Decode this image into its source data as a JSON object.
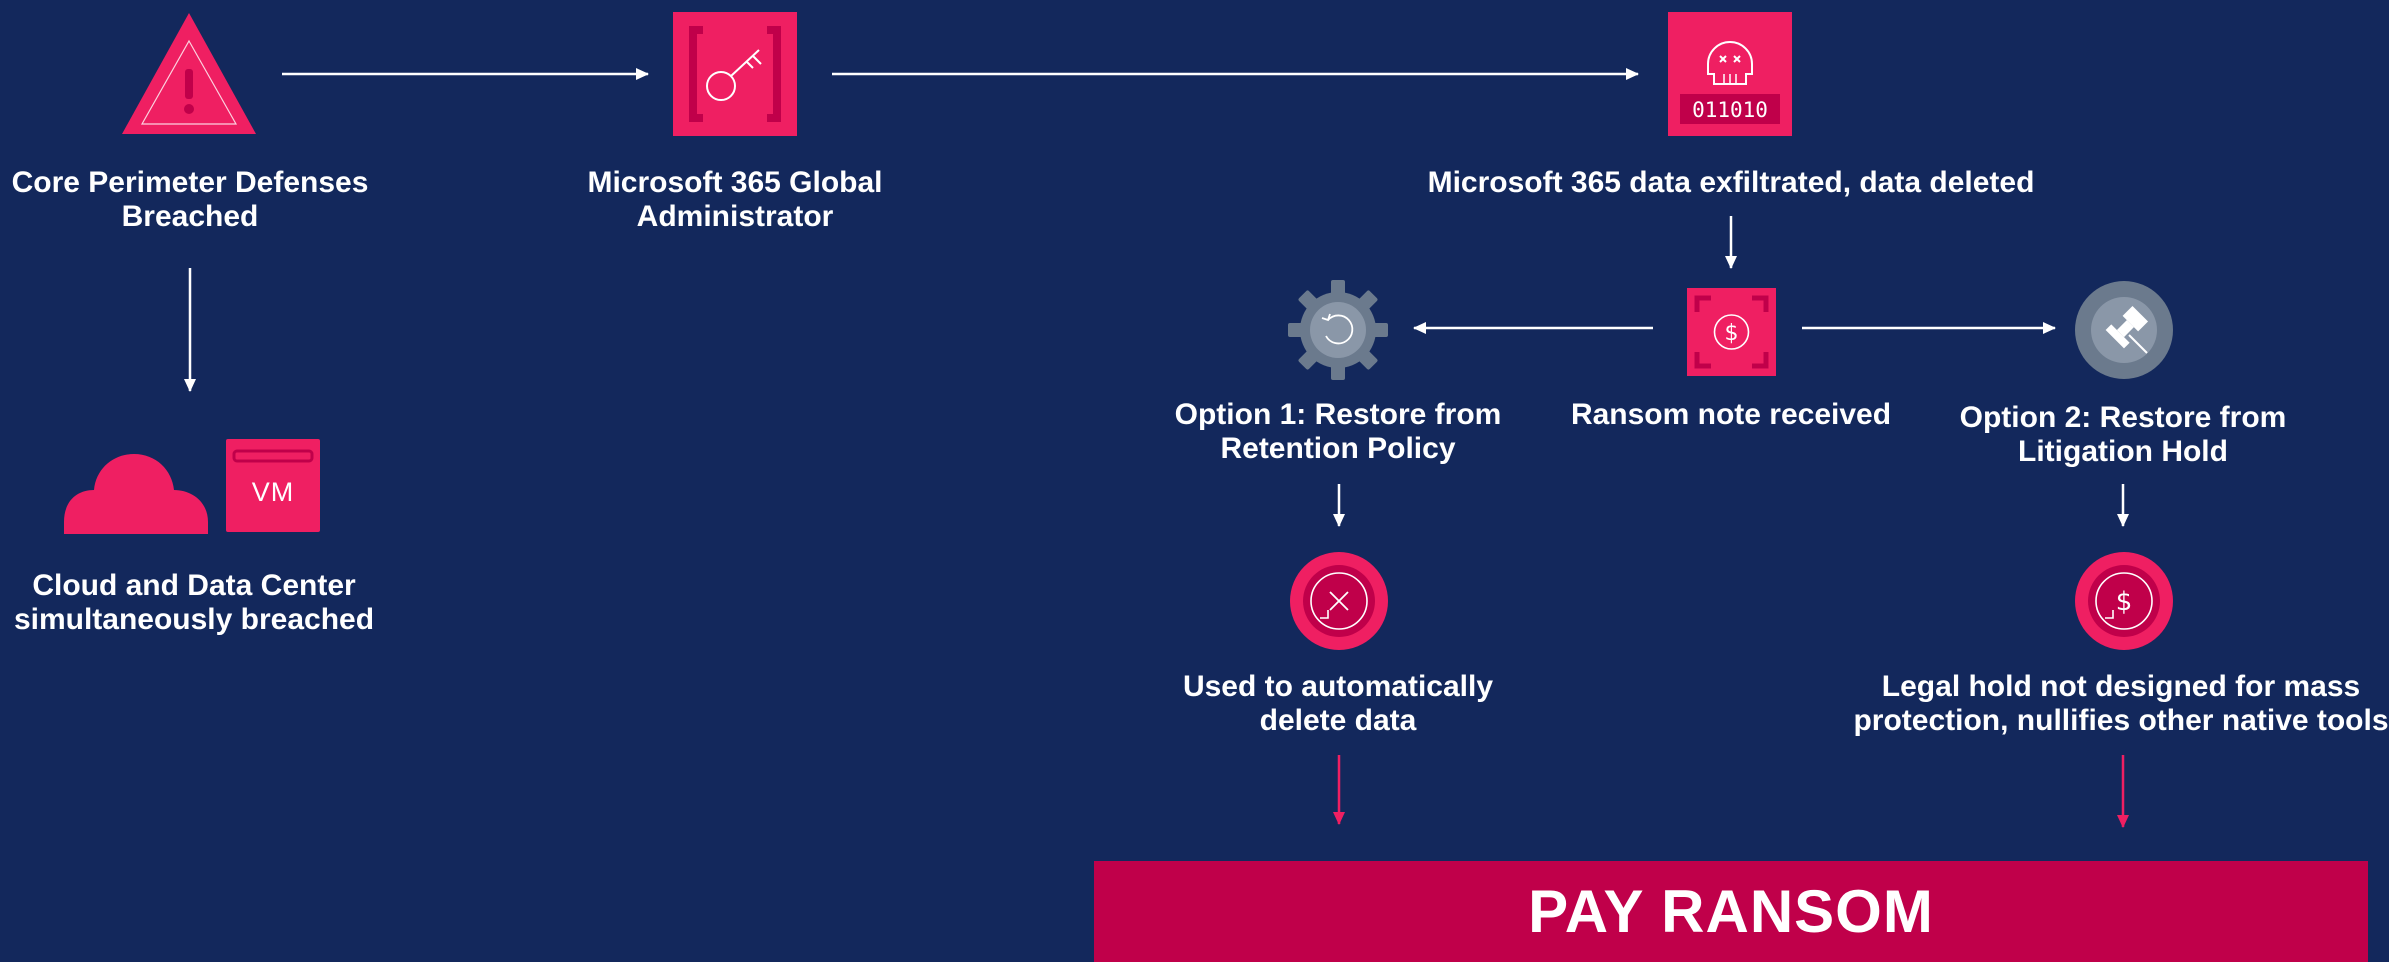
{
  "colors": {
    "background": "#13285c",
    "accent": "#ef1f62",
    "accent_dark": "#c0004a",
    "gray": "#6b7a8d",
    "arrow_white": "#ffffff",
    "arrow_pink": "#ef1f62"
  },
  "nodes": {
    "perimeter": {
      "label_line1": "Core Perimeter Defenses",
      "label_line2": "Breached",
      "icon": "warning-triangle-icon"
    },
    "global_admin": {
      "label_line1": "Microsoft 365 Global",
      "label_line2": "Administrator",
      "icon": "admin-key-icon"
    },
    "exfiltrated": {
      "label_line1": "Microsoft 365 data exfiltrated, data deleted",
      "icon": "skull-data-icon",
      "icon_code": "011010"
    },
    "cloud_dc": {
      "label_line1": "Cloud and Data Center",
      "label_line2": "simultaneously breached",
      "icon": "cloud-icon",
      "vm_label": "VM"
    },
    "ransom_note": {
      "label_line1": "Ransom note received",
      "icon": "ransom-dollar-icon"
    },
    "option1": {
      "label_line1": "Option 1: Restore from",
      "label_line2": "Retention Policy",
      "icon": "gear-restore-icon"
    },
    "option2": {
      "label_line1": "Option 2: Restore from",
      "label_line2": "Litigation Hold",
      "icon": "gavel-icon"
    },
    "auto_delete": {
      "label_line1": "Used to automatically",
      "label_line2": "delete data",
      "icon": "delete-cycle-icon"
    },
    "legal_hold": {
      "label_line1": "Legal hold not designed for mass",
      "label_line2": "protection, nullifies other native tools",
      "icon": "dollar-cycle-icon"
    }
  },
  "banner": {
    "label": "PAY RANSOM"
  }
}
